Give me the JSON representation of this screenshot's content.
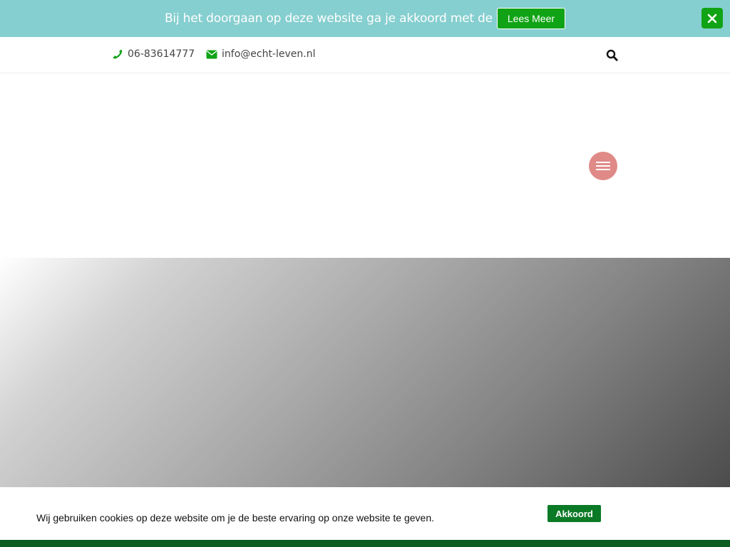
{
  "notice": {
    "text": "Bij het doorgaan op deze website ga je akkoord met de",
    "button_label": "Lees Meer",
    "close_icon": "close-icon"
  },
  "contact": {
    "phone": "06-83614777",
    "phone_icon": "phone-icon",
    "email": "info@echt-leven.nl",
    "email_icon": "envelope-icon",
    "search_icon": "search-icon"
  },
  "header": {
    "menu_icon": "hamburger-menu-icon"
  },
  "cookie": {
    "text": "Wij gebruiken cookies op deze website om je de beste ervaring op onze website te geven.",
    "button_label": "Akkoord"
  },
  "colors": {
    "notice_bg": "#86cfd0",
    "accent_green": "#11a316",
    "dark_green": "#0b7a26",
    "menu_toggle": "#e08a88"
  }
}
